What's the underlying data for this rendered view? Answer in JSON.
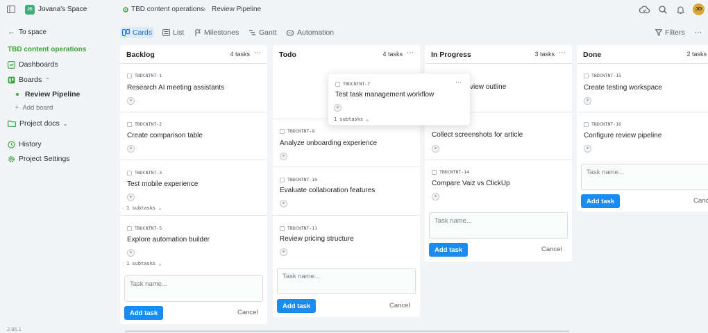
{
  "topbar": {
    "workspace_badge": "JS",
    "workspace_name": "Jovana's Space",
    "breadcrumb": [
      "TBD content operations",
      "Review Pipeline"
    ],
    "avatar_initials": "JO"
  },
  "sidebar": {
    "back_label": "To space",
    "project_name": "TBD content operations",
    "items": [
      {
        "label": "Dashboards",
        "icon": "dashboard-icon"
      },
      {
        "label": "Boards",
        "icon": "board-icon"
      },
      {
        "label": "Review Pipeline",
        "icon": "dot-icon"
      },
      {
        "label": "Add board",
        "icon": "plus-icon"
      },
      {
        "label": "Project docs",
        "icon": "folder-icon"
      },
      {
        "label": "History",
        "icon": "history-icon"
      },
      {
        "label": "Project Settings",
        "icon": "gear-icon"
      }
    ],
    "version": "2.86.1"
  },
  "views": {
    "tabs": [
      "Cards",
      "List",
      "Milestones",
      "Gantt",
      "Automation"
    ],
    "active": "Cards",
    "filters_label": "Filters"
  },
  "columns": [
    {
      "title": "Backlog",
      "count": "4 tasks",
      "cards": [
        {
          "id": "TBDCNTNT-1",
          "title": "Research AI meeting assistants",
          "subtasks": ""
        },
        {
          "id": "TBDCNTNT-2",
          "title": "Create comparison table",
          "subtasks": ""
        },
        {
          "id": "TBDCNTNT-3",
          "title": "Test mobile experience",
          "subtasks": "1 subtasks"
        },
        {
          "id": "TBDCNTNT-5",
          "title": "Explore automation builder",
          "subtasks": "1 subtasks"
        }
      ]
    },
    {
      "title": "Todo",
      "count": "4 tasks",
      "cards": [
        {
          "id": "TBDCNTNT-9",
          "title": "Analyze onboarding experience",
          "subtasks": ""
        },
        {
          "id": "TBDCNTNT-10",
          "title": "Evaluate collaboration features",
          "subtasks": ""
        },
        {
          "id": "TBDCNTNT-11",
          "title": "Review pricing structure",
          "subtasks": ""
        }
      ]
    },
    {
      "title": "In Progress",
      "count": "3 tasks",
      "cards": [
        {
          "id": "",
          "title": "view outline",
          "subtasks": ""
        },
        {
          "id": "",
          "title": "Collect screenshots for article",
          "subtasks": ""
        },
        {
          "id": "TBDCNTNT-14",
          "title": "Compare Vaiz vs ClickUp",
          "subtasks": ""
        }
      ]
    },
    {
      "title": "Done",
      "count": "2 tasks",
      "cards": [
        {
          "id": "TBDCNTNT-15",
          "title": "Create testing workspace",
          "subtasks": ""
        },
        {
          "id": "TBDCNTNT-16",
          "title": "Configure review pipeline",
          "subtasks": ""
        }
      ]
    }
  ],
  "dragging_card": {
    "id": "TBDCNTNT-7",
    "title": "Test task management workflow",
    "subtasks": "1 subtasks"
  },
  "composer": {
    "placeholder": "Task name...",
    "add_label": "Add task",
    "cancel_label": "Cancel",
    "cancel_truncated": "Canc"
  },
  "colors": {
    "accent": "#1a8cf0",
    "green": "#3aa33a",
    "active_tab_bg": "#dbe9fb"
  }
}
